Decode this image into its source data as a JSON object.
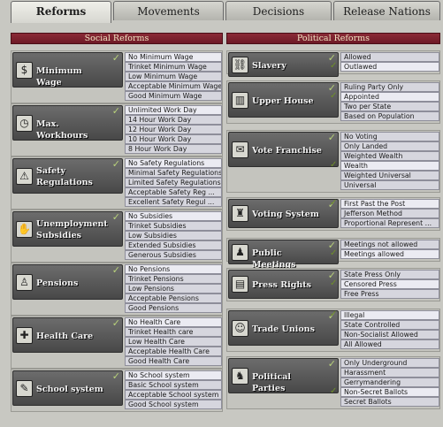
{
  "tabs": [
    "Reforms",
    "Movements",
    "Decisions",
    "Release Nations"
  ],
  "active_tab": 0,
  "headers": {
    "social": "Social Reforms",
    "political": "Political Reforms"
  },
  "social": [
    {
      "name": "Minimum Wage",
      "icon": "coin-icon",
      "glyph": "$",
      "selected": 0,
      "options": [
        "No Minimum Wage",
        "Trinket Minimum Wage",
        "Low Minimum Wage",
        "Acceptable Minimum Wage",
        "Good Minimum Wage"
      ]
    },
    {
      "name": "Max. Workhours",
      "icon": "clock-icon",
      "glyph": "◷",
      "selected": 0,
      "options": [
        "Unlimited Work Day",
        "14 Hour Work Day",
        "12 Hour Work Day",
        "10 Hour Work Day",
        "8 Hour Work Day"
      ]
    },
    {
      "name": "Safety Regulations",
      "icon": "warning-icon",
      "glyph": "⚠",
      "selected": 0,
      "options": [
        "No Safety Regulations",
        "Minimal Safety Regulations",
        "Limited Safety Regulations",
        "Acceptable Safety Reg ...",
        "Excellent Safety Regul ..."
      ]
    },
    {
      "name": "Unemployment Subsidies",
      "icon": "hand-icon",
      "glyph": "✋",
      "selected": 0,
      "options": [
        "No Subsidies",
        "Trinket Subsidies",
        "Low Subsidies",
        "Extended Subsidies",
        "Generous Subsidies"
      ]
    },
    {
      "name": "Pensions",
      "icon": "elder-icon",
      "glyph": "♙",
      "selected": 0,
      "options": [
        "No Pensions",
        "Trinket Pensions",
        "Low Pensions",
        "Acceptable Pensions",
        "Good Pensions"
      ]
    },
    {
      "name": "Health Care",
      "icon": "medical-icon",
      "glyph": "✚",
      "selected": 0,
      "options": [
        "No Health Care",
        "Trinket Health care",
        "Low Health Care",
        "Acceptable Health Care",
        "Good Health Care"
      ]
    },
    {
      "name": "School system",
      "icon": "school-icon",
      "glyph": "✎",
      "selected": 0,
      "options": [
        "No School system",
        "Basic School system",
        "Acceptable School system",
        "Good School system"
      ]
    }
  ],
  "political": [
    {
      "name": "Slavery",
      "icon": "chains-icon",
      "glyph": "⛓",
      "selected": 1,
      "options": [
        "Allowed",
        "Outlawed"
      ]
    },
    {
      "name": "Upper House",
      "icon": "building-icon",
      "glyph": "▥",
      "selected": 1,
      "options": [
        "Ruling Party Only",
        "Appointed",
        "Two per State",
        "Based on Population"
      ]
    },
    {
      "name": "Vote Franchise",
      "icon": "ballot-box-icon",
      "glyph": "✉",
      "selected": 3,
      "options": [
        "No Voting",
        "Only Landed",
        "Weighted Wealth",
        "Wealth",
        "Weighted Universal",
        "Universal"
      ]
    },
    {
      "name": "Voting System",
      "icon": "chair-icon",
      "glyph": "♜",
      "selected": 0,
      "options": [
        "First Past the Post",
        "Jefferson Method",
        "Proportional Represent ..."
      ]
    },
    {
      "name": "Public Meetings",
      "icon": "meeting-icon",
      "glyph": "♟",
      "selected": 1,
      "options": [
        "Meetings not allowed",
        "Meetings allowed"
      ]
    },
    {
      "name": "Press Rights",
      "icon": "newspaper-icon",
      "glyph": "▤",
      "selected": 1,
      "options": [
        "State Press Only",
        "Censored Press",
        "Free Press"
      ]
    },
    {
      "name": "Trade Unions",
      "icon": "union-icon",
      "glyph": "☺",
      "selected": 0,
      "options": [
        "Illegal",
        "State Controlled",
        "Non-Socialist Allowed",
        "All Allowed"
      ]
    },
    {
      "name": "Political Parties",
      "icon": "elephant-icon",
      "glyph": "♞",
      "selected": 3,
      "options": [
        "Only Underground",
        "Harassment",
        "Gerrymandering",
        "Non-Secret Ballots",
        "Secret Ballots"
      ]
    }
  ]
}
